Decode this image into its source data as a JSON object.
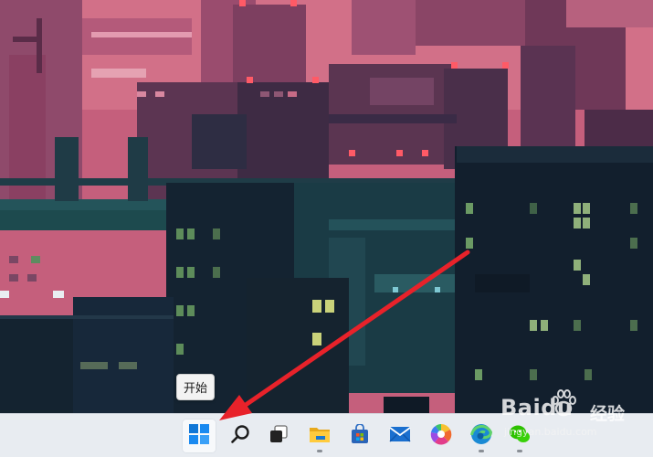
{
  "tooltip": {
    "text": "开始"
  },
  "taskbar": {
    "items": [
      {
        "name": "start",
        "icon": "windows-logo-icon",
        "active": true
      },
      {
        "name": "search",
        "icon": "search-icon"
      },
      {
        "name": "task-view",
        "icon": "task-view-icon"
      },
      {
        "name": "file-explorer",
        "icon": "folder-icon",
        "running": true
      },
      {
        "name": "store",
        "icon": "store-bag-icon"
      },
      {
        "name": "mail",
        "icon": "mail-icon"
      },
      {
        "name": "photos",
        "icon": "photos-pinwheel-icon"
      },
      {
        "name": "edge",
        "icon": "edge-browser-icon",
        "running": true
      },
      {
        "name": "wechat",
        "icon": "chat-bubble-icon",
        "running": true
      }
    ]
  },
  "watermark": {
    "brand": "Baidu",
    "brand_cn": "经验",
    "url": "jingyan.baidu.com"
  },
  "colors": {
    "annotation_arrow": "#e8222a",
    "taskbar_bg": "#e8ecf1",
    "wallpaper_sky": "#c9607d",
    "wallpaper_buildings": "#152433"
  }
}
